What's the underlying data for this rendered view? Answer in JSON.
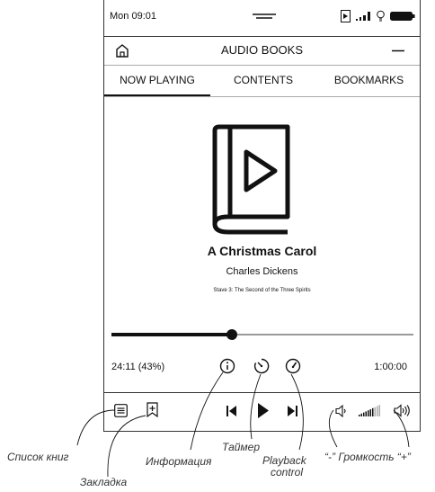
{
  "status_bar": {
    "time": "Mon 09:01"
  },
  "header": {
    "title": "AUDIO BOOKS"
  },
  "tabs": [
    {
      "label": "NOW PLAYING",
      "active": true
    },
    {
      "label": "CONTENTS",
      "active": false
    },
    {
      "label": "BOOKMARKS",
      "active": false
    }
  ],
  "book": {
    "title": "A Christmas Carol",
    "author": "Charles Dickens",
    "chapter": "Stave 3: The Second of the Three Spirits"
  },
  "playback": {
    "elapsed": "24:11 (43%)",
    "total": "1:00:00",
    "progress_fraction": 0.4,
    "volume_level_fraction": 0.7
  },
  "annotations": {
    "book_list": "Список книг",
    "bookmark": "Закладка",
    "info": "Информация",
    "timer": "Таймер",
    "playback_control_1": "Playback",
    "playback_control_2": "control",
    "volume": "“-” Громкость “+”"
  },
  "icons": [
    "home-icon",
    "menu-icon",
    "battery-icon",
    "wifi-signal-icon",
    "bulb-icon",
    "audio-status-icon",
    "book-play-icon",
    "info-icon",
    "timer-icon",
    "speed-icon",
    "book-list-icon",
    "bookmark-icon",
    "previous-icon",
    "play-icon",
    "next-icon",
    "volume-down-icon",
    "volume-level-icon",
    "volume-up-icon"
  ]
}
